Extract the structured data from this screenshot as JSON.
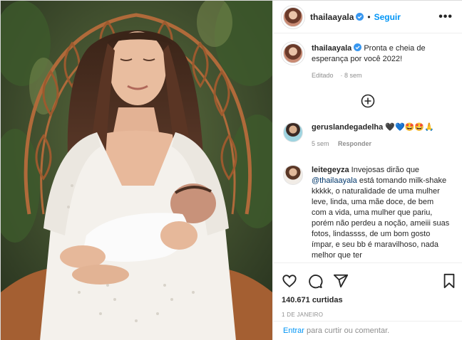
{
  "post": {
    "username": "thailaayala",
    "follow_label": "Seguir",
    "separator": "•"
  },
  "caption": {
    "username": "thailaayala",
    "text": "Pronta e cheia de esperança por você 2022!",
    "edited": "Editado",
    "time": "8 sem"
  },
  "comments": [
    {
      "username": "geruslandegadelha",
      "text": "🖤💙🤩🤩🙏",
      "time": "5 sem",
      "reply": "Responder"
    },
    {
      "username": "leitegeyza",
      "text_before": "Invejosas dirão que",
      "mention": "@thailaayala",
      "text_after": "está tomando milk-shake kkkkk, o naturalidade de uma mulher leve, linda, uma mãe doce, de bem com a vida, uma mulher que pariu, porém não perdeu a noção, ameiii suas fotos, lindassss, de um bom gosto ímpar, e seu bb é maravilhoso, nada melhor que ter"
    }
  ],
  "likes": "140.671 curtidas",
  "date": "1 DE JANEIRO",
  "add_comment": {
    "enter": "Entrar",
    "rest": "para curtir ou comentar."
  },
  "colors": {
    "link": "#0095f6",
    "muted": "#8e8e8e",
    "text": "#262626"
  }
}
